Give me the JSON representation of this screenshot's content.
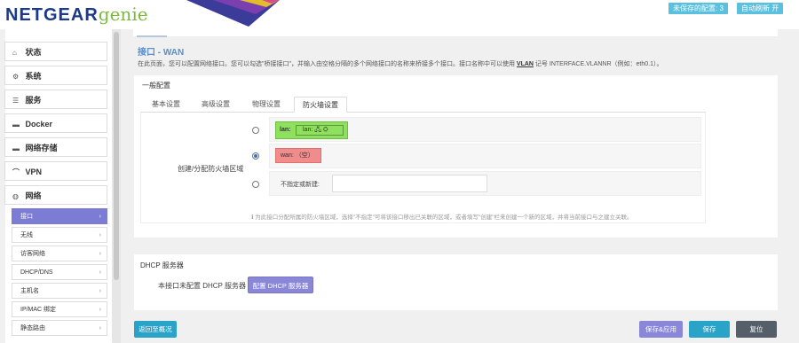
{
  "header": {
    "logo_brand": "NETGEAR",
    "logo_product": "genie",
    "unsaved_badge": "未保存的配置: 3",
    "auto_refresh": "自动刷新 开"
  },
  "sidebar": {
    "items": [
      {
        "label": "状态",
        "icon": "home-icon",
        "glyph": "⌂"
      },
      {
        "label": "系统",
        "icon": "gear-icon",
        "glyph": "⚙"
      },
      {
        "label": "服务",
        "icon": "list-icon",
        "glyph": "☰"
      },
      {
        "label": "Docker",
        "icon": "docker-icon",
        "glyph": "▬"
      },
      {
        "label": "网络存储",
        "icon": "storage-icon",
        "glyph": "▬"
      },
      {
        "label": "VPN",
        "icon": "vpn-icon",
        "glyph": "⌒"
      },
      {
        "label": "网络",
        "icon": "globe-icon",
        "glyph": "◍"
      }
    ],
    "subitems": [
      "接口",
      "无线",
      "访客网络",
      "DHCP/DNS",
      "主机名",
      "IP/MAC 绑定",
      "静态路由"
    ],
    "chevron": "›"
  },
  "page": {
    "title": "接口 - WAN",
    "desc_before": "在此页面，您可以配置网络接口。您可以勾选\"桥接接口\"，并输入由空格分隔的多个网络接口的名称来桥接多个接口。接口名称中可以使用 ",
    "desc_vlan": "VLAN",
    "desc_after": " 记号 INTERFACE.VLANNR（例如：eth0.1）。"
  },
  "general": {
    "title": "一般配置",
    "tabs": [
      "基本设置",
      "高级设置",
      "物理设置",
      "防火墙设置"
    ],
    "active_tab": 3,
    "zone_label": "创建/分配防火墙区域",
    "lan_label": "lan:",
    "lan_inner": "lan: 🖧 ⛭",
    "wan_label": "wan: （空）",
    "new_label": "不指定或新建:",
    "new_value": "",
    "selected_zone": "wan",
    "help": "为此接口分配所属的防火墙区域，选择\"不指定\"可将该接口移出已关联的区域，或者填写\"创建\"栏来创建一个新的区域，并将当前接口与之建立关联。"
  },
  "dhcp": {
    "title": "DHCP 服务器",
    "label": "本接口未配置 DHCP 服务器",
    "button": "配置 DHCP 服务器"
  },
  "actions": {
    "back": "返回至概况",
    "save_apply": "保存&应用",
    "save": "保存",
    "reset": "复位"
  },
  "colors": {
    "accent": "#2aa3c9",
    "purple": "#8a86d8",
    "lan_zone": "#90e060",
    "wan_zone": "#f08c8c"
  }
}
